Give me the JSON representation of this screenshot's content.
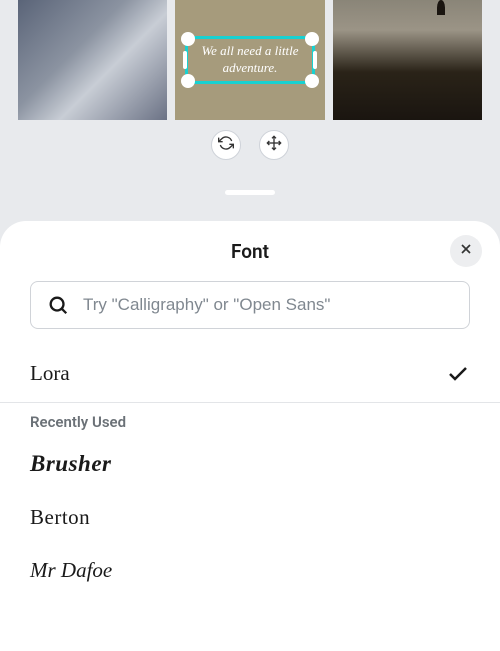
{
  "canvas": {
    "selected_text": "We all need a little adventure."
  },
  "sheet": {
    "title": "Font",
    "search_placeholder": "Try \"Calligraphy\" or \"Open Sans\"",
    "selected_font": "Lora",
    "recently_used_label": "Recently Used",
    "fonts": {
      "brusher": "Brusher",
      "berton": "Berton",
      "mrdafoe": "Mr Dafoe"
    }
  }
}
